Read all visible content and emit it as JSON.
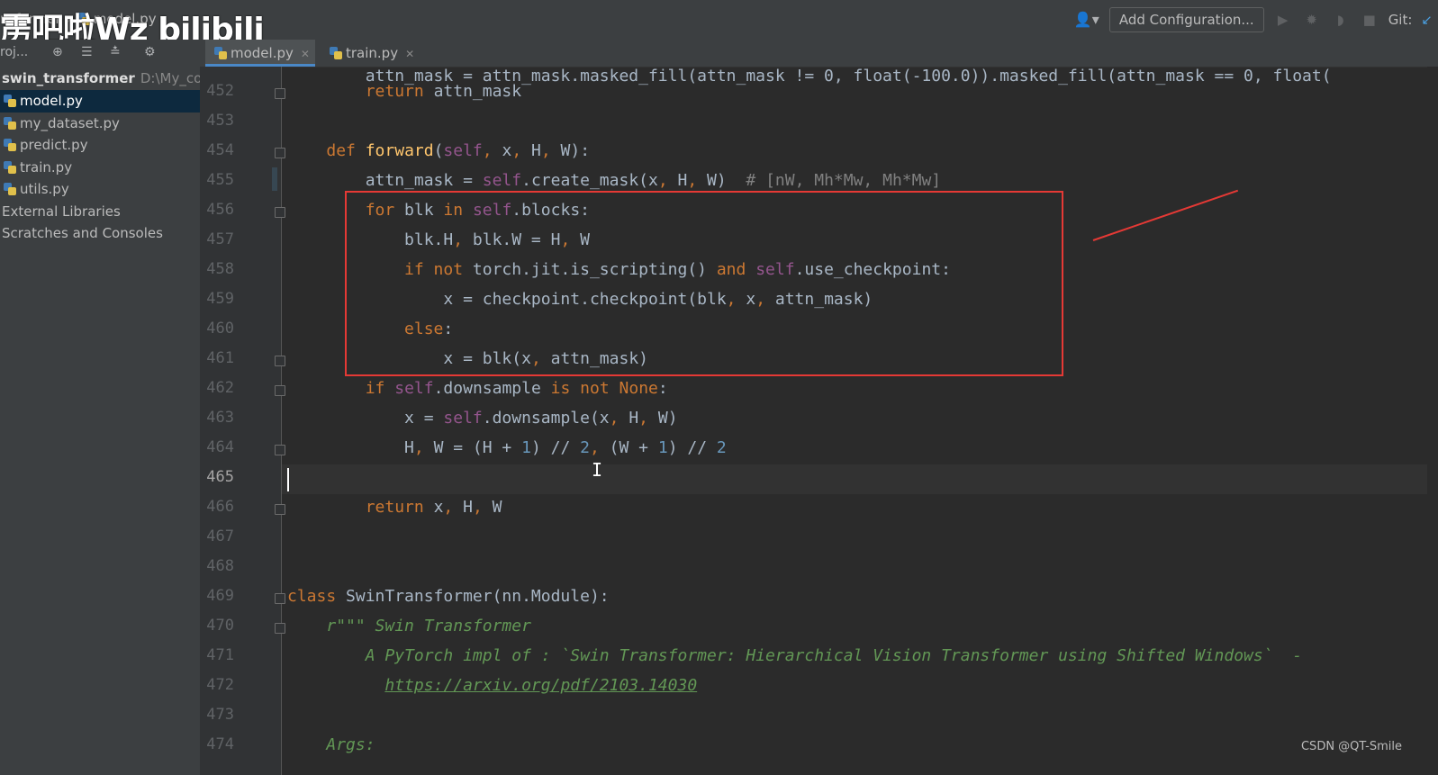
{
  "breadcrumb": {
    "project": "nsformer",
    "file": "model.py"
  },
  "watermark": "雳吧啦Wz bilibili",
  "toolbar": {
    "add_configuration": "Add Configuration...",
    "git_label": "Git:"
  },
  "subbar": {
    "label": "roj..."
  },
  "tabs": [
    {
      "label": "model.py",
      "active": true
    },
    {
      "label": "train.py",
      "active": false
    }
  ],
  "project_tree": {
    "root_name": "swin_transformer",
    "root_path": "D:\\My_code",
    "files": [
      "model.py",
      "my_dataset.py",
      "predict.py",
      "train.py",
      "utils.py"
    ],
    "selected": "model.py",
    "extra": [
      "External Libraries",
      "Scratches and Consoles"
    ]
  },
  "editor": {
    "current_line": "465",
    "line_numbers": [
      "452",
      "453",
      "454",
      "455",
      "456",
      "457",
      "458",
      "459",
      "460",
      "461",
      "462",
      "463",
      "464",
      "465",
      "466",
      "467",
      "468",
      "469",
      "470",
      "471",
      "472",
      "473",
      "474"
    ]
  },
  "footer": {
    "credit": "CSDN @QT-Smile"
  }
}
